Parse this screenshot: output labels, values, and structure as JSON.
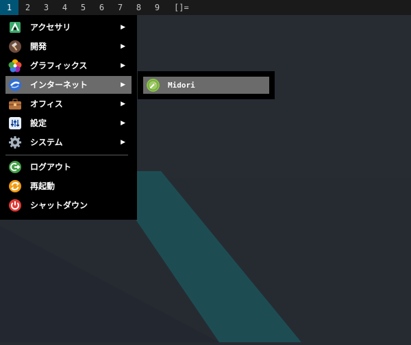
{
  "topbar": {
    "workspaces": [
      "1",
      "2",
      "3",
      "4",
      "5",
      "6",
      "7",
      "8",
      "9"
    ],
    "active_workspace": "1",
    "layout_symbol": "[]="
  },
  "menu": {
    "items": [
      {
        "label": "アクセサリ",
        "icon": "accessories-icon",
        "submenu": true
      },
      {
        "label": "開発",
        "icon": "development-icon",
        "submenu": true
      },
      {
        "label": "グラフィックス",
        "icon": "graphics-icon",
        "submenu": true
      },
      {
        "label": "インターネット",
        "icon": "internet-icon",
        "submenu": true,
        "highlighted": true
      },
      {
        "label": "オフィス",
        "icon": "office-icon",
        "submenu": true
      },
      {
        "label": "設定",
        "icon": "settings-icon",
        "submenu": true
      },
      {
        "label": "システム",
        "icon": "system-icon",
        "submenu": true
      },
      {
        "label": "ログアウト",
        "icon": "logout-icon",
        "submenu": false
      },
      {
        "label": "再起動",
        "icon": "reboot-icon",
        "submenu": false
      },
      {
        "label": "シャットダウン",
        "icon": "shutdown-icon",
        "submenu": false
      }
    ],
    "arrow": "▶"
  },
  "submenu": {
    "items": [
      {
        "label": "Midori",
        "icon": "midori-icon"
      }
    ]
  },
  "colors": {
    "topbar_bg": "#1a1a1a",
    "active_workspace_bg": "#005577",
    "menu_bg": "#000000",
    "highlight_bg": "#6b6b6b",
    "desktop_bg": "#262b32",
    "accent_stripe": "#1d4d52"
  }
}
